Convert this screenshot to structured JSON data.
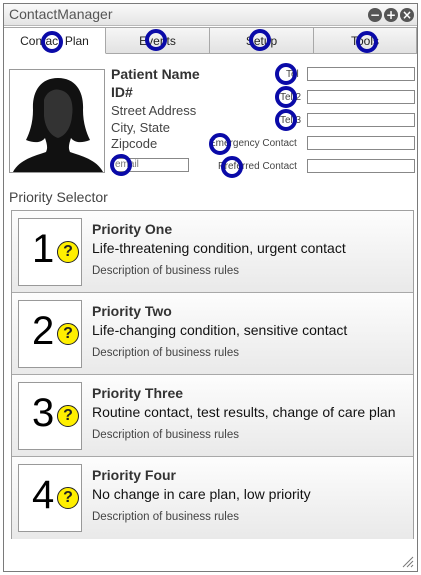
{
  "window": {
    "title": "ContactManager",
    "controls": [
      {
        "icon": "minimize-icon",
        "glyph": "−"
      },
      {
        "icon": "maximize-icon",
        "glyph": "+"
      },
      {
        "icon": "close-icon",
        "glyph": "×"
      }
    ]
  },
  "tabs": [
    {
      "label": "Contact Plan",
      "active": true
    },
    {
      "label": "Events",
      "active": false
    },
    {
      "label": "Setup",
      "active": false
    },
    {
      "label": "Tools",
      "active": false
    }
  ],
  "patient": {
    "name": "Patient Name",
    "id": "ID#",
    "street": "Street Address",
    "city_state": "City, State",
    "zip": "Zipcode",
    "email_placeholder": "email"
  },
  "contact_fields": {
    "tel1": {
      "label": "Tel",
      "value": ""
    },
    "tel2": {
      "label": "Tel 2",
      "value": ""
    },
    "tel3": {
      "label": "Tel 3",
      "value": ""
    },
    "emergency": {
      "label": "Emergency Contact",
      "value": ""
    },
    "preferred": {
      "label": "Preferred Contact",
      "value": ""
    }
  },
  "priority_selector": {
    "title": "Priority Selector",
    "items": [
      {
        "number": "1",
        "title": "Priority One",
        "subtitle": "Life-threatening condition, urgent contact",
        "description": "Description of business rules"
      },
      {
        "number": "2",
        "title": "Priority Two",
        "subtitle": "Life-changing condition, sensitive contact",
        "description": "Description of business rules"
      },
      {
        "number": "3",
        "title": "Priority Three",
        "subtitle": "Routine contact, test results, change of care plan",
        "description": "Description of business rules"
      },
      {
        "number": "4",
        "title": "Priority Four",
        "subtitle": "No change in care plan, low priority",
        "description": "Description of business rules"
      }
    ],
    "help_glyph": "?"
  },
  "colors": {
    "marker": "#0a0aa8",
    "help_badge": "#ffef00"
  }
}
